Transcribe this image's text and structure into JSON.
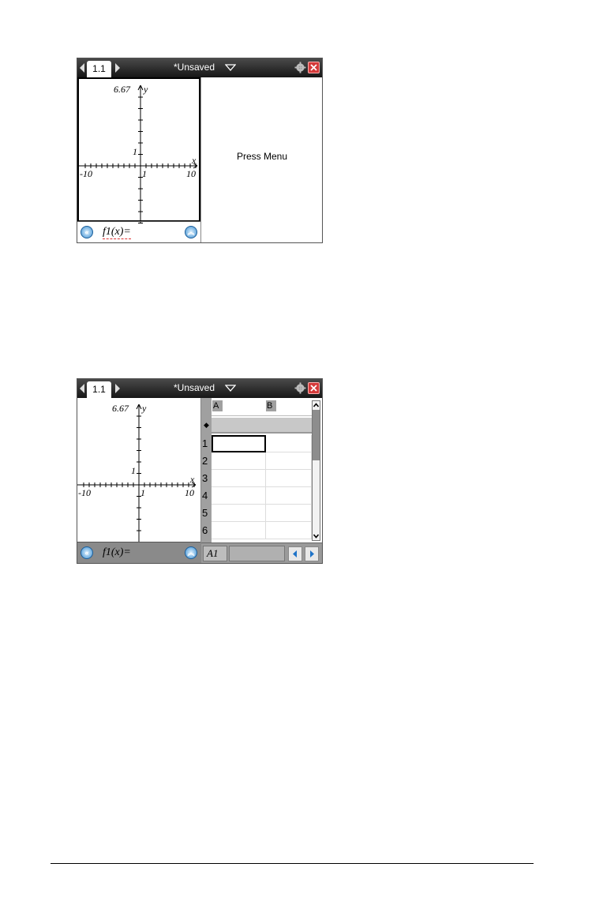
{
  "screen1": {
    "tab_label": "1.1",
    "doc_title": "*Unsaved",
    "graph": {
      "ymax_label": "6.67",
      "y_axis_label": "y",
      "x_axis_label": "x",
      "xmin_label": "-10",
      "xmax_label": "10",
      "x_tick_label": "1",
      "y_tick_label": "1"
    },
    "entry_line": {
      "text": "f1(x)="
    },
    "right_pane": {
      "message": "Press Menu"
    }
  },
  "screen2": {
    "tab_label": "1.1",
    "doc_title": "*Unsaved",
    "graph": {
      "ymax_label": "6.67",
      "y_axis_label": "y",
      "x_axis_label": "x",
      "xmin_label": "-10",
      "xmax_label": "10",
      "x_tick_label": "1",
      "y_tick_label": "1"
    },
    "entry_line": {
      "text": "f1(x)="
    },
    "spreadsheet": {
      "columns": [
        "A",
        "B"
      ],
      "formula_row_marker": "◆",
      "rows": [
        "1",
        "2",
        "3",
        "4",
        "5",
        "6"
      ],
      "current_cell": "A1"
    }
  }
}
